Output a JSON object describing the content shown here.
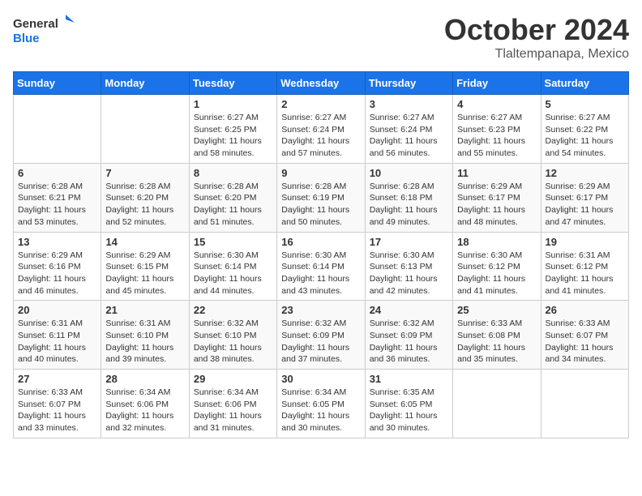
{
  "header": {
    "logo_general": "General",
    "logo_blue": "Blue",
    "month": "October 2024",
    "location": "Tlaltempanapa, Mexico"
  },
  "weekdays": [
    "Sunday",
    "Monday",
    "Tuesday",
    "Wednesday",
    "Thursday",
    "Friday",
    "Saturday"
  ],
  "weeks": [
    [
      {
        "day": "",
        "info": ""
      },
      {
        "day": "",
        "info": ""
      },
      {
        "day": "1",
        "info": "Sunrise: 6:27 AM\nSunset: 6:25 PM\nDaylight: 11 hours and 58 minutes."
      },
      {
        "day": "2",
        "info": "Sunrise: 6:27 AM\nSunset: 6:24 PM\nDaylight: 11 hours and 57 minutes."
      },
      {
        "day": "3",
        "info": "Sunrise: 6:27 AM\nSunset: 6:24 PM\nDaylight: 11 hours and 56 minutes."
      },
      {
        "day": "4",
        "info": "Sunrise: 6:27 AM\nSunset: 6:23 PM\nDaylight: 11 hours and 55 minutes."
      },
      {
        "day": "5",
        "info": "Sunrise: 6:27 AM\nSunset: 6:22 PM\nDaylight: 11 hours and 54 minutes."
      }
    ],
    [
      {
        "day": "6",
        "info": "Sunrise: 6:28 AM\nSunset: 6:21 PM\nDaylight: 11 hours and 53 minutes."
      },
      {
        "day": "7",
        "info": "Sunrise: 6:28 AM\nSunset: 6:20 PM\nDaylight: 11 hours and 52 minutes."
      },
      {
        "day": "8",
        "info": "Sunrise: 6:28 AM\nSunset: 6:20 PM\nDaylight: 11 hours and 51 minutes."
      },
      {
        "day": "9",
        "info": "Sunrise: 6:28 AM\nSunset: 6:19 PM\nDaylight: 11 hours and 50 minutes."
      },
      {
        "day": "10",
        "info": "Sunrise: 6:28 AM\nSunset: 6:18 PM\nDaylight: 11 hours and 49 minutes."
      },
      {
        "day": "11",
        "info": "Sunrise: 6:29 AM\nSunset: 6:17 PM\nDaylight: 11 hours and 48 minutes."
      },
      {
        "day": "12",
        "info": "Sunrise: 6:29 AM\nSunset: 6:17 PM\nDaylight: 11 hours and 47 minutes."
      }
    ],
    [
      {
        "day": "13",
        "info": "Sunrise: 6:29 AM\nSunset: 6:16 PM\nDaylight: 11 hours and 46 minutes."
      },
      {
        "day": "14",
        "info": "Sunrise: 6:29 AM\nSunset: 6:15 PM\nDaylight: 11 hours and 45 minutes."
      },
      {
        "day": "15",
        "info": "Sunrise: 6:30 AM\nSunset: 6:14 PM\nDaylight: 11 hours and 44 minutes."
      },
      {
        "day": "16",
        "info": "Sunrise: 6:30 AM\nSunset: 6:14 PM\nDaylight: 11 hours and 43 minutes."
      },
      {
        "day": "17",
        "info": "Sunrise: 6:30 AM\nSunset: 6:13 PM\nDaylight: 11 hours and 42 minutes."
      },
      {
        "day": "18",
        "info": "Sunrise: 6:30 AM\nSunset: 6:12 PM\nDaylight: 11 hours and 41 minutes."
      },
      {
        "day": "19",
        "info": "Sunrise: 6:31 AM\nSunset: 6:12 PM\nDaylight: 11 hours and 41 minutes."
      }
    ],
    [
      {
        "day": "20",
        "info": "Sunrise: 6:31 AM\nSunset: 6:11 PM\nDaylight: 11 hours and 40 minutes."
      },
      {
        "day": "21",
        "info": "Sunrise: 6:31 AM\nSunset: 6:10 PM\nDaylight: 11 hours and 39 minutes."
      },
      {
        "day": "22",
        "info": "Sunrise: 6:32 AM\nSunset: 6:10 PM\nDaylight: 11 hours and 38 minutes."
      },
      {
        "day": "23",
        "info": "Sunrise: 6:32 AM\nSunset: 6:09 PM\nDaylight: 11 hours and 37 minutes."
      },
      {
        "day": "24",
        "info": "Sunrise: 6:32 AM\nSunset: 6:09 PM\nDaylight: 11 hours and 36 minutes."
      },
      {
        "day": "25",
        "info": "Sunrise: 6:33 AM\nSunset: 6:08 PM\nDaylight: 11 hours and 35 minutes."
      },
      {
        "day": "26",
        "info": "Sunrise: 6:33 AM\nSunset: 6:07 PM\nDaylight: 11 hours and 34 minutes."
      }
    ],
    [
      {
        "day": "27",
        "info": "Sunrise: 6:33 AM\nSunset: 6:07 PM\nDaylight: 11 hours and 33 minutes."
      },
      {
        "day": "28",
        "info": "Sunrise: 6:34 AM\nSunset: 6:06 PM\nDaylight: 11 hours and 32 minutes."
      },
      {
        "day": "29",
        "info": "Sunrise: 6:34 AM\nSunset: 6:06 PM\nDaylight: 11 hours and 31 minutes."
      },
      {
        "day": "30",
        "info": "Sunrise: 6:34 AM\nSunset: 6:05 PM\nDaylight: 11 hours and 30 minutes."
      },
      {
        "day": "31",
        "info": "Sunrise: 6:35 AM\nSunset: 6:05 PM\nDaylight: 11 hours and 30 minutes."
      },
      {
        "day": "",
        "info": ""
      },
      {
        "day": "",
        "info": ""
      }
    ]
  ]
}
